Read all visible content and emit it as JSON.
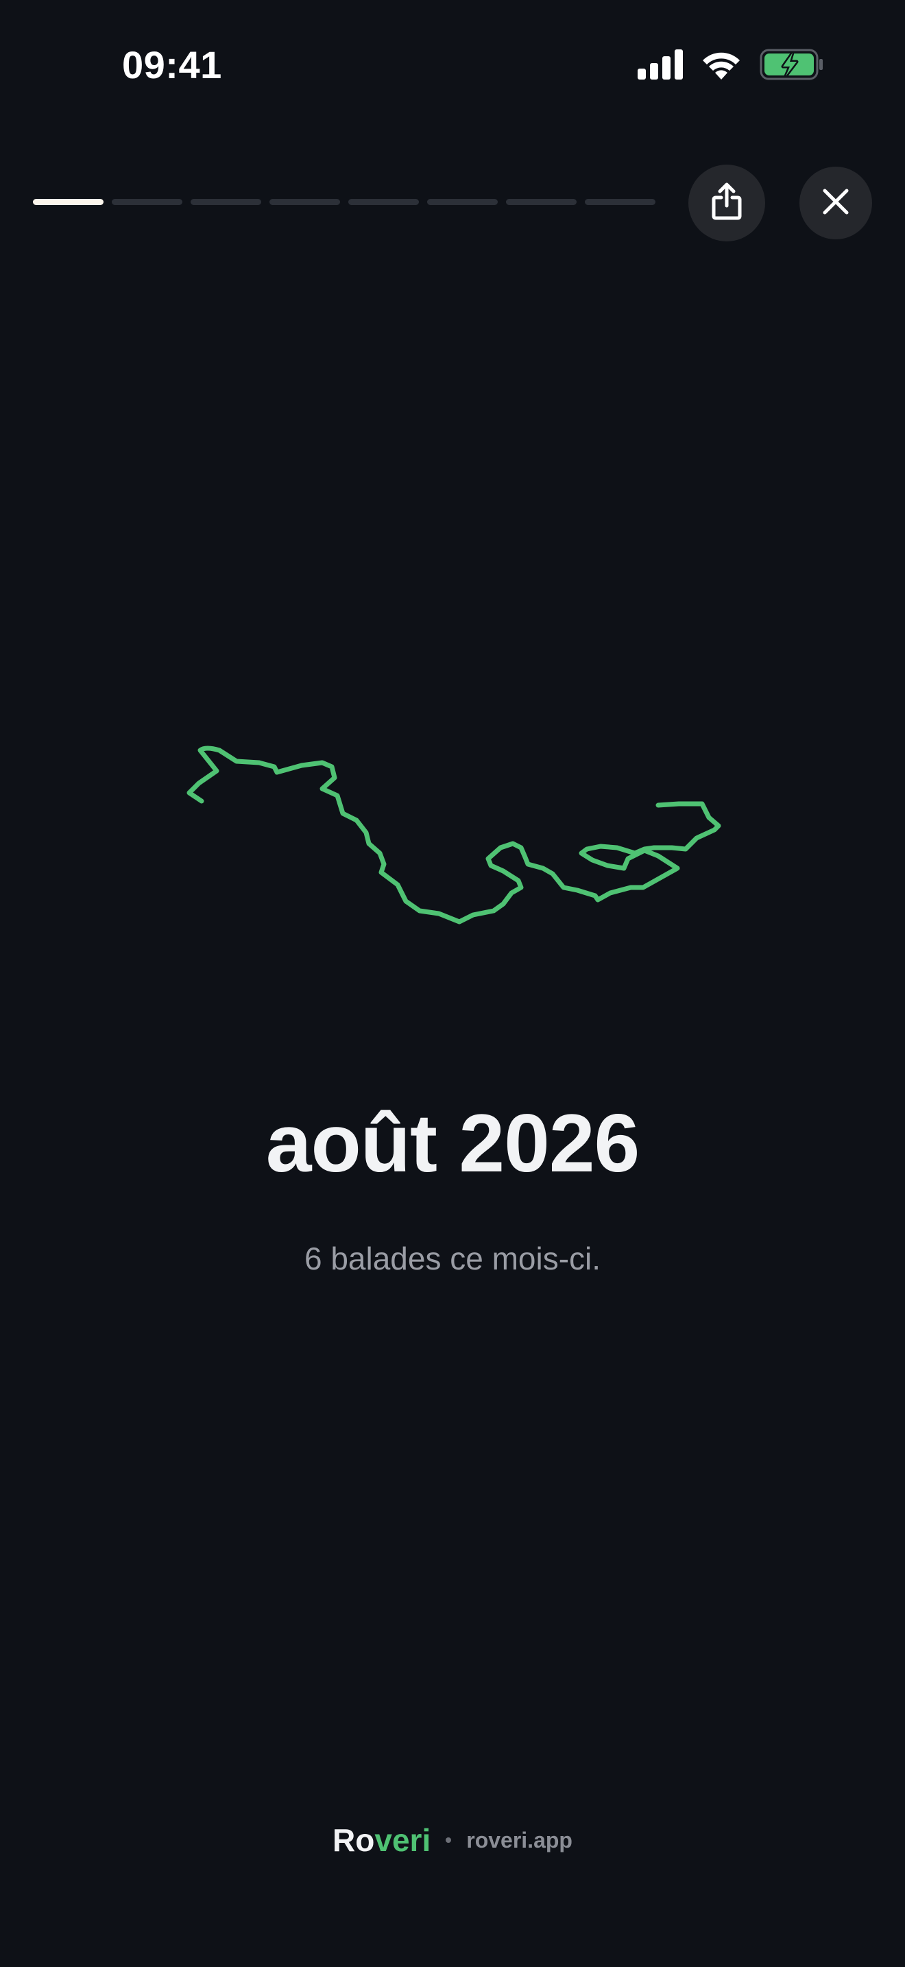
{
  "status_bar": {
    "time": "09:41",
    "icons": [
      "signal-icon",
      "wifi-icon",
      "battery-charging-icon"
    ]
  },
  "story": {
    "segments_total": 8,
    "active_segment": 1,
    "share_icon": "share-icon",
    "close_icon": "close-icon"
  },
  "main": {
    "title": "août 2026",
    "subtitle": "6 balades ce mois-ci."
  },
  "footer": {
    "brand_part1": "Ro",
    "brand_part2": "veri",
    "separator": "•",
    "site": "roveri.app"
  },
  "colors": {
    "background": "#0e1117",
    "accent": "#4fc273",
    "title": "#f2f3f5",
    "subtitle": "#9a9da5"
  }
}
